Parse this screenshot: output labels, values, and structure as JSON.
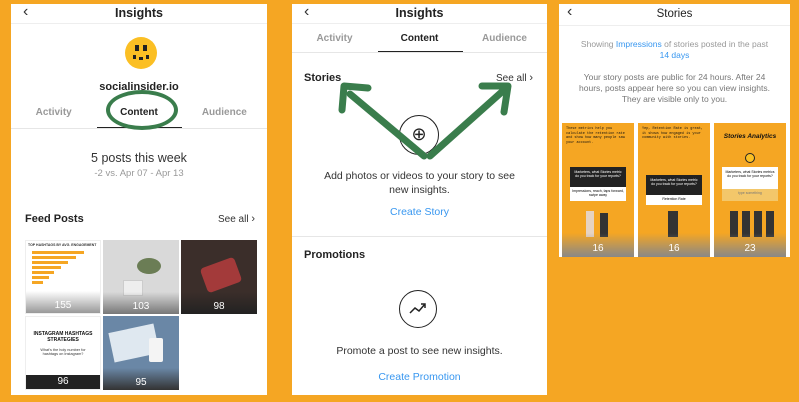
{
  "panel1": {
    "title": "Insights",
    "account": "socialinsider.io",
    "tabs": [
      "Activity",
      "Content",
      "Audience"
    ],
    "summary": "5 posts this week",
    "comparison": "-2 vs. Apr 07 - Apr 13",
    "feed_title": "Feed Posts",
    "see_all": "See all",
    "thumbs": [
      {
        "count": "155",
        "caption": "TOP HASHTAGS BY AVG. ENGAGEMENT"
      },
      {
        "count": "103",
        "caption": ""
      },
      {
        "count": "98",
        "caption": ""
      },
      {
        "count": "96",
        "caption": "INSTAGRAM HASHTAGS STRATEGIES",
        "sub": "What's the holy number for hashtags on Instagram?"
      },
      {
        "count": "95",
        "caption": ""
      }
    ]
  },
  "panel2": {
    "title": "Insights",
    "tabs": [
      "Activity",
      "Content",
      "Audience"
    ],
    "stories_title": "Stories",
    "see_all": "See all",
    "stories_empty": "Add photos or videos to your story to see new insights.",
    "create_story": "Create Story",
    "promotions_title": "Promotions",
    "promotions_empty": "Promote a post to see new insights.",
    "create_promotion": "Create Promotion"
  },
  "panel3": {
    "title": "Stories",
    "showing_prefix": "Showing",
    "showing_metric": "Impressions",
    "showing_suffix": "of stories posted in the past",
    "showing_period": "14 days",
    "notice": "Your story posts are public for 24 hours. After 24 hours, posts appear here so you can view insights. They are visible only to you.",
    "stories": [
      {
        "count": "16",
        "headline": "These metrics help you calculate the retention rate and show how many people saw your account.",
        "box": "Marketers, what Stories metric do you track for your reports?",
        "reply": "Impressions, reach, taps forward, swipe away"
      },
      {
        "count": "16",
        "headline": "Yep, Retention Rate is great, it shows how engaged is your community with stories.",
        "box": "Marketers, what Stories metric do you track for your reports?",
        "reply": "Retention Rate"
      },
      {
        "count": "23",
        "headline": "Stories Analytics",
        "box": "Marketers, what Stories metrics do you track for your reports?",
        "reply": "type something"
      }
    ]
  },
  "colors": {
    "border": "#f5a623",
    "accent_blue": "#3897f0",
    "annotation_green": "#3a7d4c"
  }
}
